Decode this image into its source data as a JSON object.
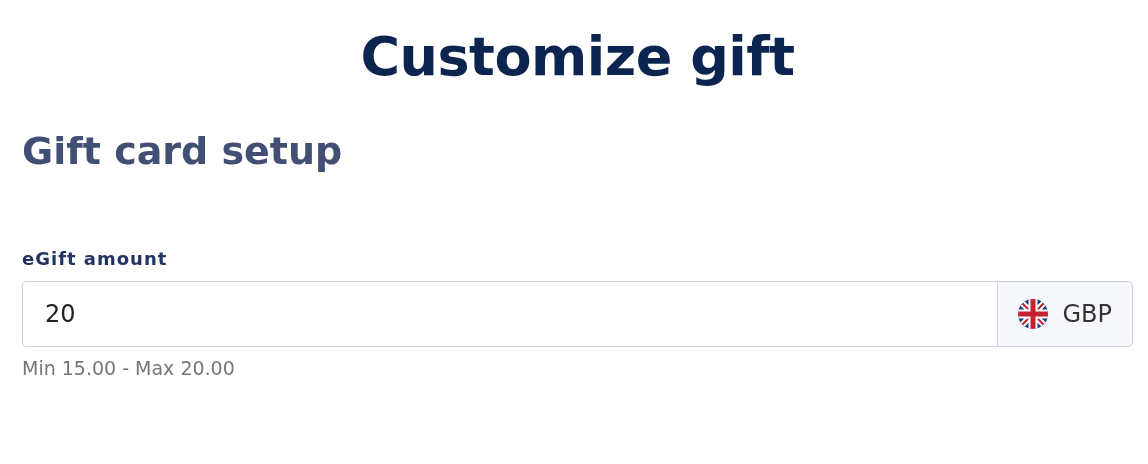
{
  "page_title": "Customize gift",
  "section_title": "Gift card setup",
  "amount_field": {
    "label": "eGift amount",
    "value": "20",
    "currency": "GBP",
    "hint": "Min 15.00 - Max 20.00"
  }
}
